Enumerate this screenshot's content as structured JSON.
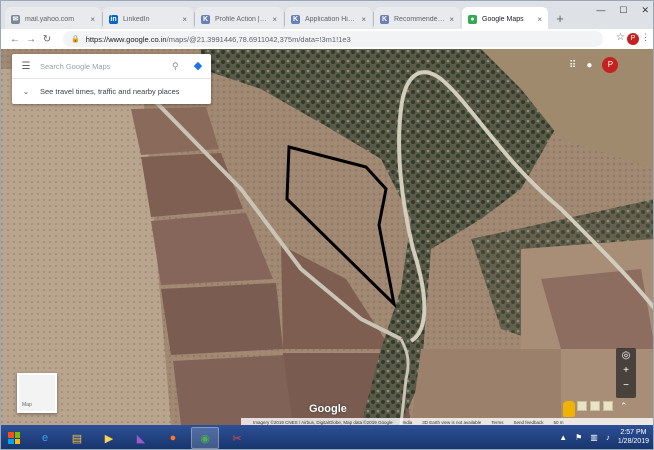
{
  "browser": {
    "tabs": [
      {
        "label": "mail.yahoo.com",
        "favicon": "mail-icon",
        "favicon_color": "#7b8794",
        "active": false
      },
      {
        "label": "LinkedIn",
        "favicon": "linkedin-icon",
        "favicon_color": "#0a66c2",
        "active": false
      },
      {
        "label": "Profile Action | Myn",
        "favicon": "k-logo-icon",
        "favicon_color": "#6a7fb5",
        "active": false
      },
      {
        "label": "Application History",
        "favicon": "k-logo-icon",
        "favicon_color": "#6a7fb5",
        "active": false
      },
      {
        "label": "Recommended Jobs",
        "favicon": "k-logo-icon",
        "favicon_color": "#6a7fb5",
        "active": false
      },
      {
        "label": "Google Maps",
        "favicon": "google-maps-icon",
        "favicon_color": "#34a853",
        "active": true
      }
    ],
    "url_host": "https://www.google.co.in",
    "url_path": "/maps/@21.3991446,78.6911042,375m/data=!3m1!1e3",
    "profile_initial": "P"
  },
  "map": {
    "search_placeholder": "Search Google Maps",
    "travel_text": "See travel times, traffic and nearby places",
    "account_initial": "P",
    "layer_label": "Map",
    "logo_text": "Google",
    "attribution": [
      "Imagery ©2019 CNES / Airbus, DigitalGlobe, Map data ©2019 Google",
      "India",
      "3D Earth view is not available",
      "Terms",
      "Send feedback",
      "50 m"
    ]
  },
  "taskbar": {
    "time": "2:57 PM",
    "date": "1/28/2019"
  }
}
